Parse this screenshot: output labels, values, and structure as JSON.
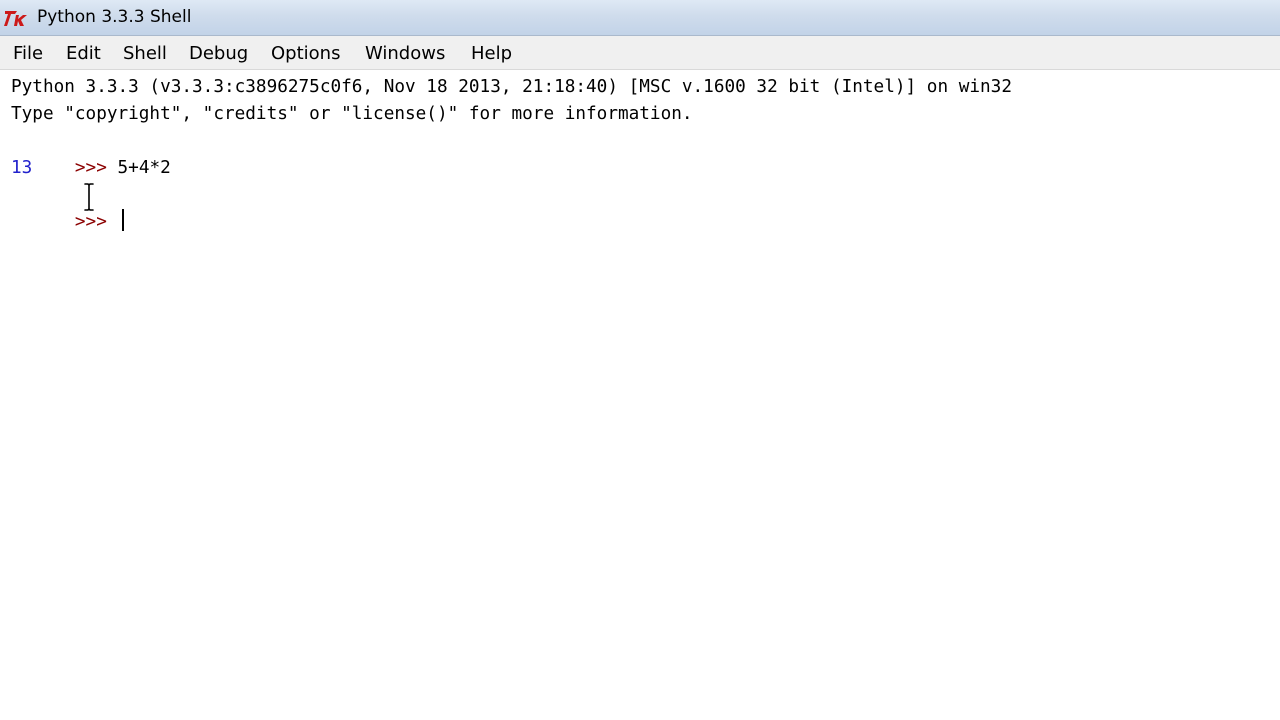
{
  "window": {
    "title": "Python 3.3.3 Shell",
    "icon": "tk-feather-icon"
  },
  "menubar": {
    "items": [
      {
        "label": "File"
      },
      {
        "label": "Edit"
      },
      {
        "label": "Shell"
      },
      {
        "label": "Debug"
      },
      {
        "label": "Options"
      },
      {
        "label": "Windows"
      },
      {
        "label": "Help"
      }
    ]
  },
  "shell": {
    "banner_line1": "Python 3.3.3 (v3.3.3:c3896275c0f6, Nov 18 2013, 21:18:40) [MSC v.1600 32 bit (Intel)] on win32",
    "banner_line2": "Type \"copyright\", \"credits\" or \"license()\" for more information.",
    "prompt": ">>> ",
    "input1": "5+4*2",
    "output1": "13",
    "current_input": ""
  },
  "colors": {
    "prompt": "#8b0000",
    "output": "#2222cc",
    "titlebar": "#cfdcec",
    "menubar": "#f0f0f0"
  }
}
